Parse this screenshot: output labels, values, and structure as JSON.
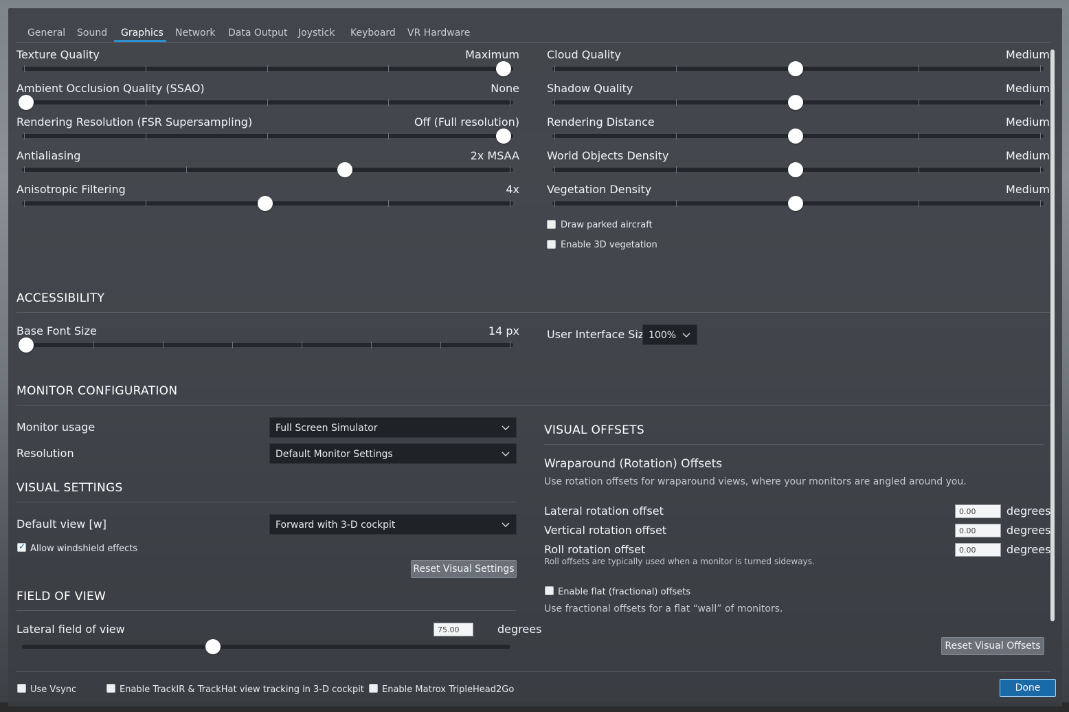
{
  "tabs": [
    {
      "label": "General",
      "active": false
    },
    {
      "label": "Sound",
      "active": false
    },
    {
      "label": "Graphics",
      "active": true
    },
    {
      "label": "Network",
      "active": false
    },
    {
      "label": "Data Output",
      "active": false
    },
    {
      "label": "Joystick",
      "active": false
    },
    {
      "label": "Keyboard",
      "active": false
    },
    {
      "label": "VR Hardware",
      "active": false
    }
  ],
  "graphics_left": [
    {
      "label": "Texture Quality",
      "value": "Maximum",
      "level": 1.0
    },
    {
      "label": "Ambient Occlusion Quality (SSAO)",
      "value": "None",
      "level": 0.0
    },
    {
      "label": "Rendering Resolution (FSR Supersampling)",
      "value": "Off (Full resolution)",
      "level": 1.0
    },
    {
      "label": "Antialiasing",
      "value": "2x MSAA",
      "level": 0.667
    },
    {
      "label": "Anisotropic Filtering",
      "value": "4x",
      "level": 0.5
    }
  ],
  "graphics_right": [
    {
      "label": "Cloud Quality",
      "value": "Medium",
      "level": 0.5
    },
    {
      "label": "Shadow Quality",
      "value": "Medium",
      "level": 0.5
    },
    {
      "label": "Rendering Distance",
      "value": "Medium",
      "level": 0.5
    },
    {
      "label": "World Objects Density",
      "value": "Medium",
      "level": 0.5
    },
    {
      "label": "Vegetation Density",
      "value": "Medium",
      "level": 0.5
    }
  ],
  "graphics_checkboxes": [
    {
      "label": "Draw parked aircraft",
      "checked": false
    },
    {
      "label": "Enable 3D vegetation",
      "checked": false
    }
  ],
  "accessibility": {
    "title": "ACCESSIBILITY",
    "base_font_label": "Base Font Size",
    "base_font_value": "14 px",
    "base_font_level": 0.0,
    "ui_size_label": "User Interface Size",
    "ui_size_value": "100%"
  },
  "monitor": {
    "title": "MONITOR CONFIGURATION",
    "usage_label": "Monitor usage",
    "usage_value": "Full Screen Simulator",
    "resolution_label": "Resolution",
    "resolution_value": "Default Monitor Settings"
  },
  "visual_settings": {
    "title": "VISUAL SETTINGS",
    "default_view_label": "Default view [w]",
    "default_view_value": "Forward with 3-D cockpit",
    "windshield_label": "Allow windshield effects",
    "windshield_checked": true,
    "reset_label": "Reset Visual Settings"
  },
  "fov": {
    "title": "FIELD OF VIEW",
    "lateral_label": "Lateral field of view",
    "lateral_value": "75.00",
    "unit": "degrees",
    "level": 0.38
  },
  "visual_offsets": {
    "title": "VISUAL OFFSETS",
    "wrap_title": "Wraparound (Rotation) Offsets",
    "wrap_desc": "Use rotation offsets for wraparound views, where your monitors are angled around you.",
    "lateral_label": "Lateral rotation offset",
    "lateral_value": "0.00",
    "vertical_label": "Vertical rotation offset",
    "vertical_value": "0.00",
    "roll_label": "Roll rotation offset",
    "roll_value": "0.00",
    "unit": "degrees",
    "roll_note": "Roll offsets are typically used when a monitor is turned sideways.",
    "flat_label": "Enable flat (fractional) offsets",
    "flat_checked": false,
    "flat_desc": "Use fractional offsets for a flat “wall” of monitors.",
    "reset_label": "Reset Visual Offsets"
  },
  "footer": {
    "vsync_label": "Use Vsync",
    "trackir_label": "Enable TrackIR & TrackHat view tracking in 3-D cockpit",
    "matrox_label": "Enable Matrox TripleHead2Go",
    "done_label": "Done"
  }
}
